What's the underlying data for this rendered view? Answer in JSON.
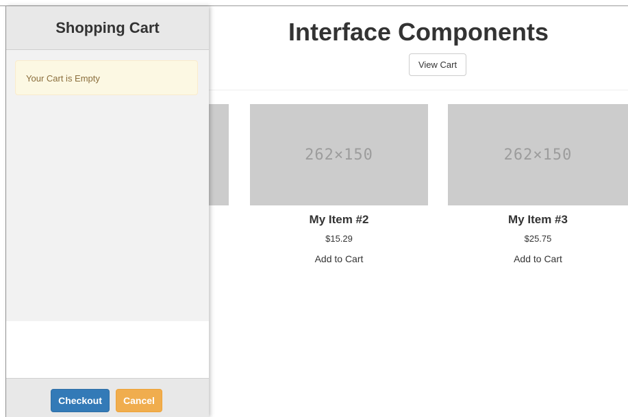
{
  "main": {
    "title": "Interface Components",
    "view_cart_label": "View Cart",
    "products": [
      {
        "thumb_text": "262×150",
        "name": "My Item #2",
        "price": "$15.29",
        "add_label": "Add to Cart"
      },
      {
        "thumb_text": "262×150",
        "name": "My Item #3",
        "price": "$25.75",
        "add_label": "Add to Cart"
      }
    ]
  },
  "cart": {
    "title": "Shopping Cart",
    "empty_message": "Your Cart is Empty",
    "checkout_label": "Checkout",
    "cancel_label": "Cancel"
  },
  "colors": {
    "primary": "#337ab7",
    "warning": "#f0ad4e",
    "alert_bg": "#fcf8e3",
    "alert_text": "#8a6d3b",
    "placeholder_bg": "#cccccc"
  }
}
